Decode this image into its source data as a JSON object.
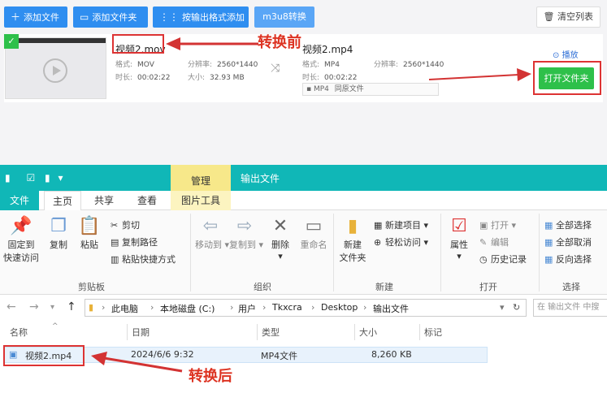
{
  "converter": {
    "toolbar": {
      "add_file": "添加文件",
      "add_folder": "添加文件夹",
      "add_by_format": "按输出格式添加",
      "m3u8": "m3u8转换",
      "clear_list": "清空列表"
    },
    "source": {
      "name": "视频2.mov",
      "format_label": "格式:",
      "format": "MOV",
      "resolution_label": "分辨率:",
      "resolution": "2560*1440",
      "duration_label": "时长:",
      "duration": "00:02:22",
      "size_label": "大小:",
      "size": "32.93 MB"
    },
    "output": {
      "name": "视频2.mp4",
      "format_label": "格式:",
      "format": "MP4",
      "resolution_label": "分辨率:",
      "resolution": "2560*1440",
      "duration_label": "时长:",
      "duration": "00:02:22",
      "preset": "MP4",
      "preset_quality": "同原文件"
    },
    "play_label": "播放",
    "open_folder": "打开文件夹",
    "annotation_before": "转换前"
  },
  "explorer": {
    "title": "输出文件",
    "contextual_tab": "管理",
    "tabs": [
      "文件",
      "主页",
      "共享",
      "查看",
      "图片工具"
    ],
    "ribbon": {
      "clipboard": {
        "label": "剪贴板",
        "pin": "固定到快速访问",
        "pin_line1": "固定到",
        "pin_line2": "快速访问",
        "copy": "复制",
        "paste": "粘贴",
        "cut": "剪切",
        "copy_path": "复制路径",
        "paste_shortcut": "粘贴快捷方式"
      },
      "organize": {
        "label": "组织",
        "move_to": "移动到",
        "copy_to": "复制到",
        "delete": "删除",
        "rename": "重命名"
      },
      "new": {
        "label": "新建",
        "new_folder_line1": "新建",
        "new_folder_line2": "文件夹",
        "new_item": "新建项目",
        "easy_access": "轻松访问"
      },
      "open": {
        "label": "打开",
        "properties": "属性",
        "open": "打开",
        "edit": "编辑",
        "history": "历史记录"
      },
      "select": {
        "label": "选择",
        "select_all": "全部选择",
        "select_none": "全部取消",
        "invert": "反向选择"
      }
    },
    "breadcrumb": [
      "此电脑",
      "本地磁盘 (C:)",
      "用户",
      "Tkxcra",
      "Desktop",
      "输出文件"
    ],
    "search_placeholder": "在 输出文件 中搜",
    "columns": [
      "名称",
      "日期",
      "类型",
      "大小",
      "标记"
    ],
    "files": [
      {
        "name": "视频2.mp4",
        "date": "2024/6/6 9:32",
        "type": "MP4文件",
        "size": "8,260 KB",
        "tag": ""
      }
    ],
    "annotation_after": "转换后"
  },
  "colors": {
    "accent_blue": "#2f8ef0",
    "green": "#2ec04a",
    "annotation_red": "#d33333",
    "explorer_teal": "#10b7b7"
  }
}
